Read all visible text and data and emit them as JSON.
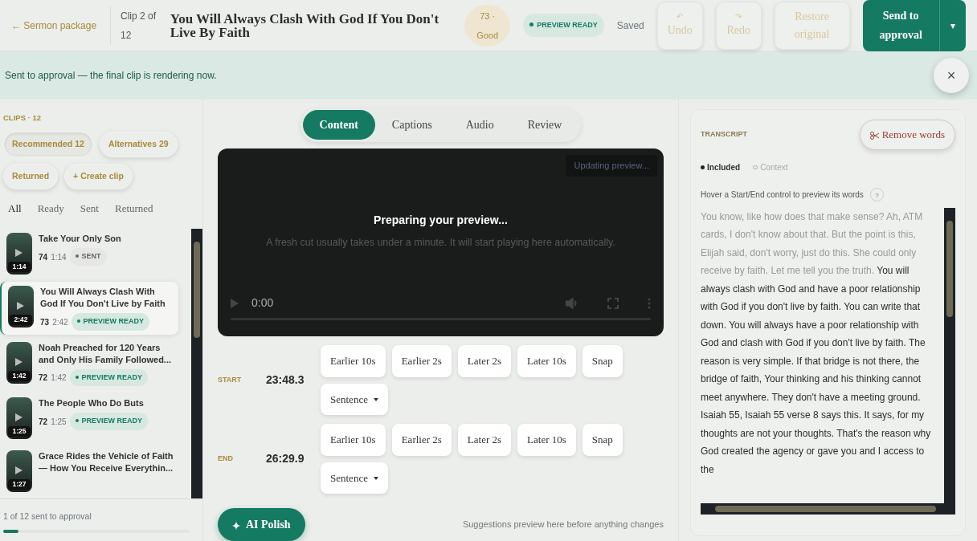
{
  "header": {
    "back_link": "← Sermon package",
    "clip_position": "Clip 2 of 12",
    "title": "You Will Always Clash With God If You Don't Live By Faith",
    "score": "73 · Good",
    "status_badge": "PREVIEW READY",
    "save_state": "Saved",
    "actions": [
      {
        "label": "Undo",
        "icon": "↶",
        "disabled": true
      },
      {
        "label": "Redo",
        "icon": "↷",
        "disabled": true
      },
      {
        "label": "Restore original",
        "disabled": true
      }
    ],
    "primary_action": {
      "label": "Send to approval",
      "caret": "▾"
    }
  },
  "banner": {
    "message": "Sent to approval — the final clip is rendering now.",
    "close": "×"
  },
  "sidebar": {
    "heading": "CLIPS · 12",
    "chips": [
      {
        "label": "Recommended 12",
        "selected": true
      },
      {
        "label": "Alternatives 29",
        "selected": false
      },
      {
        "label": "Returned",
        "selected": false
      },
      {
        "label": "+ Create clip",
        "selected": false
      }
    ],
    "filters": [
      {
        "label": "All",
        "selected": true
      },
      {
        "label": "Ready",
        "selected": false
      },
      {
        "label": "Sent",
        "selected": false
      },
      {
        "label": "Returned",
        "selected": false
      }
    ],
    "clips": [
      {
        "title": "Take Your Only Son",
        "thumb_duration": "1:14",
        "score": "74",
        "duration": "1:14",
        "status": "SENT",
        "kind": "sent",
        "selected": false
      },
      {
        "title": "You Will Always Clash With God If You Don't Live by Faith",
        "thumb_duration": "2:42",
        "score": "73",
        "duration": "2:42",
        "status": "PREVIEW READY",
        "kind": "ready",
        "selected": true
      },
      {
        "title": "Noah Preached for 120 Years and Only His Family Followed...",
        "thumb_duration": "1:42",
        "score": "72",
        "duration": "1:42",
        "status": "PREVIEW READY",
        "kind": "ready",
        "selected": false
      },
      {
        "title": "The People Who Do Buts",
        "thumb_duration": "1:25",
        "score": "72",
        "duration": "1:25",
        "status": "PREVIEW READY",
        "kind": "ready",
        "selected": false
      },
      {
        "title": "Grace Rides the Vehicle of Faith — How You Receive Everythin...",
        "thumb_duration": "1:27",
        "selected": false
      }
    ],
    "footer": {
      "text": "1 of 12 sent to approval",
      "level": 0.08
    }
  },
  "editor": {
    "tabs": [
      {
        "label": "Content",
        "selected": true
      },
      {
        "label": "Captions",
        "selected": false
      },
      {
        "label": "Audio",
        "selected": false
      },
      {
        "label": "Review",
        "selected": false
      }
    ],
    "player": {
      "badge": "Updating preview...",
      "title": "Preparing your preview...",
      "subtitle": "A fresh cut usually takes under a minute. It will start playing here automatically.",
      "time": "0:00"
    },
    "trims": [
      {
        "label": "START",
        "time": "23:48.3",
        "buttons": [
          "Earlier 10s",
          "Earlier 2s",
          "Later 2s",
          "Later 10s",
          "Snap"
        ],
        "dropdown": "Sentence"
      },
      {
        "label": "END",
        "time": "26:29.9",
        "buttons": [
          "Earlier 10s",
          "Earlier 2s",
          "Later 2s",
          "Later 10s",
          "Snap"
        ],
        "dropdown": "Sentence"
      }
    ],
    "polish_button": "AI Polish",
    "hint": "Suggestions preview here before anything changes"
  },
  "transcript": {
    "heading": "TRANSCRIPT",
    "remove_button": "Remove words",
    "legend": [
      {
        "label": "Included",
        "kind": "included"
      },
      {
        "label": "Context",
        "kind": "context"
      }
    ],
    "hint": "Hover a Start/End control to preview its words",
    "help": "?",
    "segments": [
      {
        "text": "You know, like how does that make sense?  Ah, ATM cards, I don't know about that.  But the point is this, Elijah said, don't worry, just do this.  She could only receive by faith.  Let me tell you the truth. ",
        "included": false
      },
      {
        "text": " You will always clash with God and have a poor relationship with God if you don't live by faith.  You can write that down.  You will always have a poor relationship with God and clash with God if you don't live by faith.  The reason is very simple.  If that bridge is not there, the bridge of faith, Your thinking and his thinking cannot meet anywhere.  They don't have a meeting ground.  Isaiah 55, Isaiah 55 verse 8 says this.  It says, for my thoughts are not your thoughts.  That's the reason why God created the agency or gave you and I access to the",
        "included": true
      }
    ]
  }
}
